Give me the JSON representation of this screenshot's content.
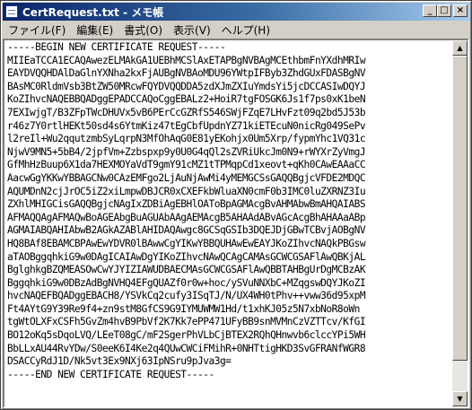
{
  "window": {
    "title": "CertRequest.txt - メモ帳",
    "app_icon": "notepad-icon",
    "controls": {
      "minimize": "_",
      "maximize": "□",
      "close": "×"
    }
  },
  "menu": [
    {
      "label": "ファイル(F)"
    },
    {
      "label": "編集(E)"
    },
    {
      "label": "書式(O)"
    },
    {
      "label": "表示(V)"
    },
    {
      "label": "ヘルプ(H)"
    }
  ],
  "document": {
    "lines": [
      "-----BEGIN NEW CERTIFICATE REQUEST-----",
      "MIIEaTCCA1ECAQAwezELMAkGA1UEBhMCSlAxETAPBgNVBAgMCEthbmFnYXdhMRIw",
      "EAYDVQQHDAlDaGlnYXNha2kxFjAUBgNVBAoMDU96YWtpIFByb3ZhdGUxFDASBgNV",
      "BAsMC0RldmVsb3BtZW50MRcwFQYDVQQDDA5zdXJmZXIuYmdsYi5jcDCCASIwDQYJ",
      "KoZIhvcNAQEBBQADggEPADCCAQoCggEBALz2+HoiR7tgFOSGK6Js1f7ps0xK1beN",
      "7EXIwjgT/B3ZFpTWcDHUVx5vB6PErCcGZRfS546SWjFZqE7LHvFzt09q2bd5J53b",
      "r46z7Y0rtlHEKt50sd4s6YtmKiz47tEgCbfUpdnYZ71kiETEcuN0nicRg049SePv",
      "l2reIl+Wu2qqutzmbSyLqrpN3MfOhAqG0E81yEKohjx0Um5Xrp/fypmYhc1VQ31c",
      "NjwV9MN5+5bB4/2jpfVm+Zzbspxp9y0U0G4qQl2sZVRiUkcJm0N9+rWYXrZyVmgJ",
      "GfMhHzBuup6X1da7HEXMOYaVdT9gmY91cMZ1tTPMqpCd1xeovt+qKh0CAwEAAaCC",
      "AacwGgYKKwYBBAGCNw0CAzEMFgo2LjAuNjAwMi4yMEMGCSsGAQQBgjcVFDE2MDQC",
      "AQUMDnN2cjJrOC5iZ2xiLmpwDBJCR0xCXEFkbWluaXN0cmF0b3IMC0luZXRNZ3Iu",
      "ZXhlMHIGCisGAQQBgjcNAgIxZDBiAgEBHlOAToBpAGMAcgBvAHMAbwBmAHQAIABS",
      "AFMAQQAgAFMAQwBoAGEAbgBuAGUAbAAgAEMAcgB5AHAAdABvAGcAcgBhAHAAaABp",
      "AGMAIABQAHIAbwB2AGkAZABlAHIDAQAwgc8GCSqGSIb3DQEJDjGBwTCBvjAOBgNV",
      "HQ8BAf8EBAMCBPAwEwYDVR0lBAwwCgYIKwYBBQUHAwEwEAYJKoZIhvcNAQkPBGsw",
      "aTAOBggqhkiG9w0DAgICAIAwDgYIKoZIhvcNAwQCAgCAMAsGCWCGSAFlAwQBKjAL",
      "BglghkgBZQMEASOwCwYJYIZIAWUDBAECMAsGCWCGSAFlAwQBBTAHBgUrDgMCBzAK",
      "BggqhkiG9w0DBzAdBgNVHQ4EFgQUAZf0r0w+hoc/ySVuNNXbC+MZqgswDQYJKoZI",
      "hvcNAQEFBQADggEBACH8/YSVkCq2cufy3ISqTJ/N/UX4WH0tPhv++vww36d95xpM",
      "Ft4AYtG9Y39Re9f4+zn9stM8GfCS9G9IYMUWMW1Hd/t1xhKJ05z5N7xbNoR8oWn",
      "tgWtOLXFxCSFh5GvZm4hvB9PbVf2K7Kk7ePP471UFyBB9snMVMnCzVZTTcv/KfGI",
      "BO12oKq5sDqoLVQ/LEeT08gC/mF2SgerPhVLbCjBTEX2RQhQHnwvb6clccYPi5WH",
      "BbLLxAU44RvYDw/S0eeK6I4Ke2q4QUwCWCiFMihR+0NHTtigHKD3SvGFRANfWGR8",
      "DSACCyRdJ1D/Nk5vt3Ex9NXj63IpNSru9pJva3g=",
      "-----END NEW CERTIFICATE REQUEST-----"
    ]
  },
  "scrollbar": {
    "up_icon": "scroll-up-arrow-icon",
    "down_icon": "scroll-down-arrow-icon"
  }
}
